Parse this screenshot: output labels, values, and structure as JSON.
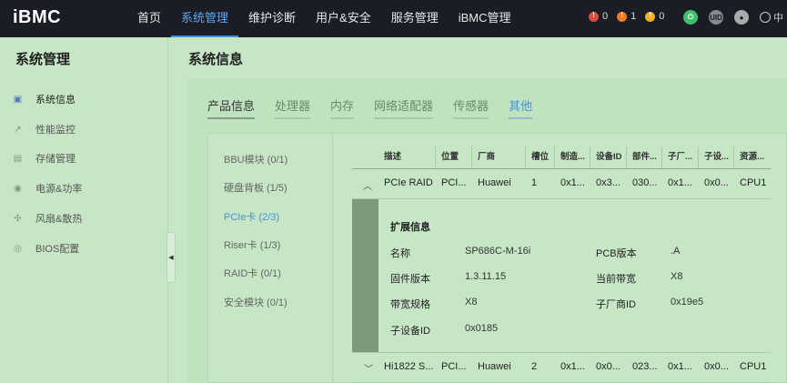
{
  "header": {
    "logo": "iBMC",
    "nav": [
      "首页",
      "系统管理",
      "维护诊断",
      "用户&安全",
      "服务管理",
      "iBMC管理"
    ],
    "active_nav": "系统管理",
    "alerts": [
      {
        "count": "0",
        "color": "#e04a3a"
      },
      {
        "count": "1",
        "color": "#f07a2a"
      },
      {
        "count": "0",
        "color": "#f0b020"
      }
    ],
    "lang": "中"
  },
  "sidebar": {
    "title": "系统管理",
    "items": [
      {
        "label": "系统信息",
        "icon": "system-info-icon"
      },
      {
        "label": "性能监控",
        "icon": "chart-icon"
      },
      {
        "label": "存储管理",
        "icon": "storage-icon"
      },
      {
        "label": "电源&功率",
        "icon": "power-icon"
      },
      {
        "label": "风扇&散热",
        "icon": "fan-icon"
      },
      {
        "label": "BIOS配置",
        "icon": "bios-icon"
      }
    ]
  },
  "main": {
    "title": "系统信息",
    "tabs": [
      "产品信息",
      "处理器",
      "内存",
      "网络适配器",
      "传感器",
      "其他"
    ],
    "subnav": [
      "BBU模块 (0/1)",
      "硬盘背板 (1/5)",
      "PCIe卡 (2/3)",
      "Riser卡 (1/3)",
      "RAID卡 (0/1)",
      "安全模块 (0/1)"
    ],
    "table": {
      "headers": [
        "描述",
        "位置",
        "厂商",
        "槽位",
        "制造...",
        "设备ID",
        "部件...",
        "子厂...",
        "子设...",
        "资源..."
      ],
      "rows": [
        [
          "PCIe RAID",
          "PCI...",
          "Huawei",
          "1",
          "0x1...",
          "0x3...",
          "030...",
          "0x1...",
          "0x0...",
          "CPU1"
        ],
        [
          "Hi1822 S...",
          "PCI...",
          "Huawei",
          "2",
          "0x1...",
          "0x0...",
          "023...",
          "0x1...",
          "0x0...",
          "CPU1"
        ]
      ],
      "expand": {
        "title": "扩展信息",
        "left": [
          {
            "k": "名称",
            "v": "SP686C-M-16i"
          },
          {
            "k": "固件版本",
            "v": "1.3.11.15"
          },
          {
            "k": "带宽规格",
            "v": "X8"
          },
          {
            "k": "子设备ID",
            "v": "0x0185"
          }
        ],
        "right": [
          {
            "k": "PCB版本",
            "v": ".A"
          },
          {
            "k": "当前带宽",
            "v": "X8"
          },
          {
            "k": "子厂商ID",
            "v": "0x19e5"
          }
        ]
      }
    }
  }
}
